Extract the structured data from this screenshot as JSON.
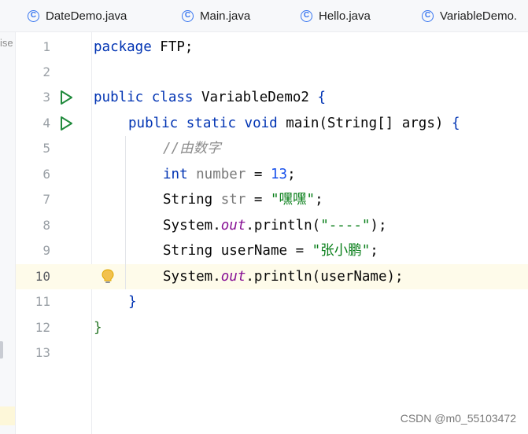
{
  "tabs": [
    {
      "label": "DateDemo.java"
    },
    {
      "label": "Main.java"
    },
    {
      "label": "Hello.java"
    },
    {
      "label": "VariableDemo."
    }
  ],
  "sidebar_cut_text": "ise",
  "lines": [
    "1",
    "2",
    "3",
    "4",
    "5",
    "6",
    "7",
    "8",
    "9",
    "10",
    "11",
    "12",
    "13"
  ],
  "code": {
    "l1_kw": "package",
    "l1_rest": " FTP;",
    "l3_kw1": "public",
    "l3_kw2": "class",
    "l3_name": " VariableDemo2 ",
    "l3_brace": "{",
    "l4_kw1": "public",
    "l4_kw2": "static",
    "l4_kw3": "void",
    "l4_rest": " main(String[] args) ",
    "l4_brace": "{",
    "l5_comment": "//由数字",
    "l6_type": "int",
    "l6_var": " number",
    "l6_eq": " = ",
    "l6_num": "13",
    "l6_end": ";",
    "l7_type": "String ",
    "l7_var": "str",
    "l7_eq": " = ",
    "l7_str": "\"嘿嘿\"",
    "l7_end": ";",
    "l8_a": "System.",
    "l8_field": "out",
    "l8_b": ".println(",
    "l8_str": "\"----\"",
    "l8_end": ");",
    "l9_a": "String userName = ",
    "l9_str": "\"张小鹏\"",
    "l9_end": ";",
    "l10_a": "System.",
    "l10_field": "out",
    "l10_b": ".println(userName);",
    "l11_brace": "}",
    "l12_brace": "}"
  },
  "watermark": "CSDN @m0_55103472"
}
